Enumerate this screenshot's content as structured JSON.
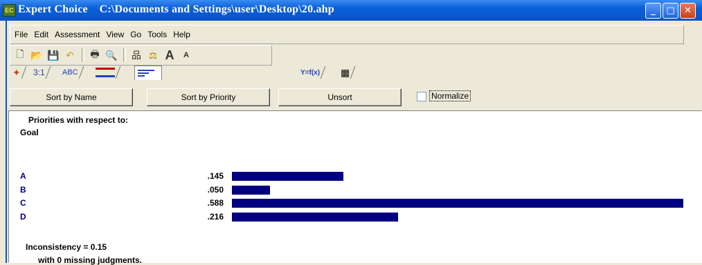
{
  "window": {
    "app_name": "Expert Choice",
    "file_path": "C:\\Documents and Settings\\user\\Desktop\\20.ahp",
    "icon_text": "EC"
  },
  "menu": [
    "File",
    "Edit",
    "Assessment",
    "View",
    "Go",
    "Tools",
    "Help"
  ],
  "toolbar_icons": [
    "new-file-icon",
    "open-folder-icon",
    "save-icon",
    "undo-icon",
    "print-icon",
    "print-preview-icon",
    "hierarchy-icon",
    "scale-icon",
    "font-larger-icon",
    "font-smaller-icon"
  ],
  "tabs": [
    {
      "name": "tab-palette",
      "label": "✦"
    },
    {
      "name": "tab-pairwise-numeric",
      "label": "3:1"
    },
    {
      "name": "tab-verbal",
      "label": "ABC"
    },
    {
      "name": "tab-graphical",
      "label": "═"
    },
    {
      "name": "tab-priorities",
      "label": "≡"
    },
    {
      "name": "tab-formula",
      "label": "Y=f(x)"
    },
    {
      "name": "tab-grid",
      "label": "▦"
    }
  ],
  "buttons": {
    "sort_name": "Sort by Name",
    "sort_priority": "Sort by Priority",
    "unsort": "Unsort",
    "normalize": "Normalize"
  },
  "priorities": {
    "heading": "Priorities with respect to:",
    "goal": "Goal",
    "items": [
      {
        "label": "A",
        "value": ".145",
        "priority": 0.145
      },
      {
        "label": "B",
        "value": ".050",
        "priority": 0.05
      },
      {
        "label": "C",
        "value": ".588",
        "priority": 0.588
      },
      {
        "label": "D",
        "value": ".216",
        "priority": 0.216
      }
    ],
    "inconsistency": "Inconsistency = 0.15",
    "missing": "with 0  missing judgments."
  },
  "colors": {
    "bar": "#000080",
    "label": "#000080",
    "titlebar": "#0a5fd8"
  }
}
